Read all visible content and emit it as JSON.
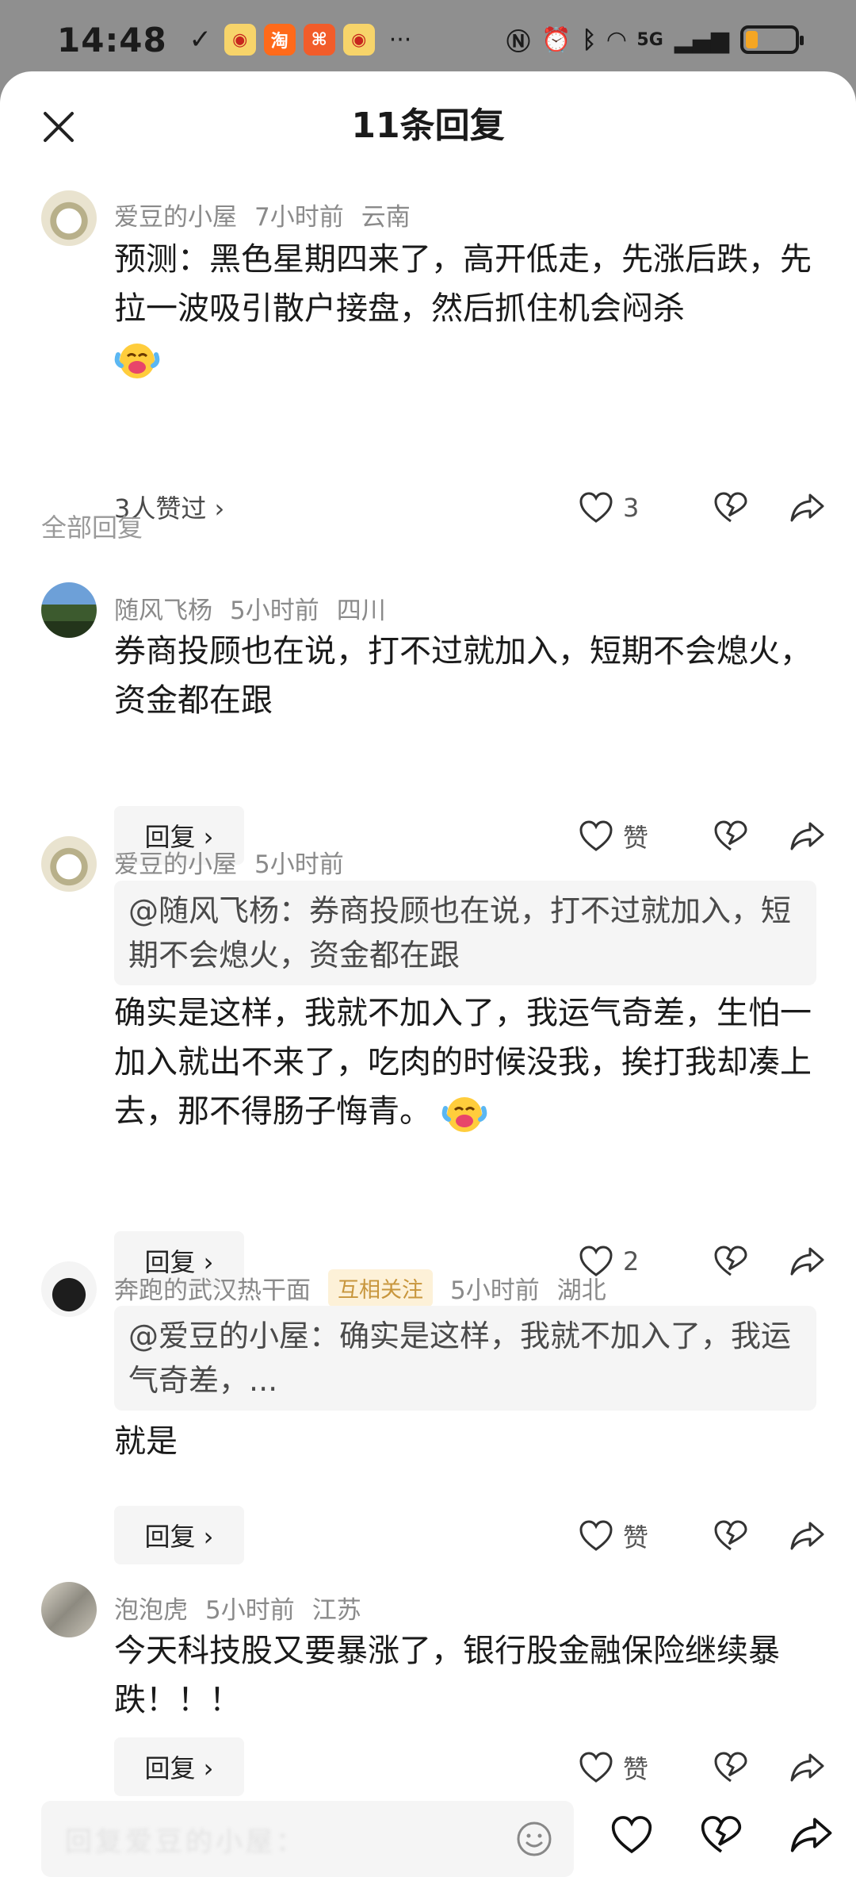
{
  "status_bar": {
    "time": "14:48",
    "app_icons": [
      "check-icon",
      "weibo-icon",
      "taobao-icon",
      "route-icon",
      "weibo-icon"
    ],
    "taobao_label": "淘",
    "more": "···",
    "network": "5G",
    "battery_level": 0.25,
    "battery_color": "#f5a623"
  },
  "sheet": {
    "title": "11条回复"
  },
  "main_comment": {
    "author": "爱豆的小屋",
    "time": "7小时前",
    "location": "云南",
    "text": "预测：黑色星期四来了，高开低走，先涨后跌，先拉一波吸引散户接盘，然后抓住机会闷杀",
    "likes_link": "3人赞过 ›",
    "like_count": "3"
  },
  "section_label": "全部回复",
  "replies": [
    {
      "author": "随风飞杨",
      "time": "5小时前",
      "location": "四川",
      "text": "券商投顾也在说，打不过就加入，短期不会熄火，资金都在跟",
      "reply_label": "回复 ›",
      "like_label": "赞"
    },
    {
      "author": "爱豆的小屋",
      "time": "5小时前",
      "quote": "@随风飞杨：券商投顾也在说，打不过就加入，短期不会熄火，资金都在跟",
      "text": "确实是这样，我就不加入了，我运气奇差，生怕一加入就出不来了，吃肉的时候没我，挨打我却凑上去，那不得肠子悔青。",
      "reply_label": "回复 ›",
      "like_label": "2"
    },
    {
      "author": "奔跑的武汉热干面",
      "badge": "互相关注",
      "time": "5小时前",
      "location": "湖北",
      "quote": "@爱豆的小屋：确实是这样，我就不加入了，我运气奇差，...",
      "text": "就是",
      "reply_label": "回复 ›",
      "like_label": "赞"
    },
    {
      "author": "泡泡虎",
      "time": "5小时前",
      "location": "江苏",
      "text": "今天科技股又要暴涨了，银行股金融保险继续暴跌！！！",
      "reply_label": "回复 ›",
      "like_label": "赞"
    }
  ],
  "bottom_bar": {
    "placeholder": "回复爱豆的小屋："
  }
}
